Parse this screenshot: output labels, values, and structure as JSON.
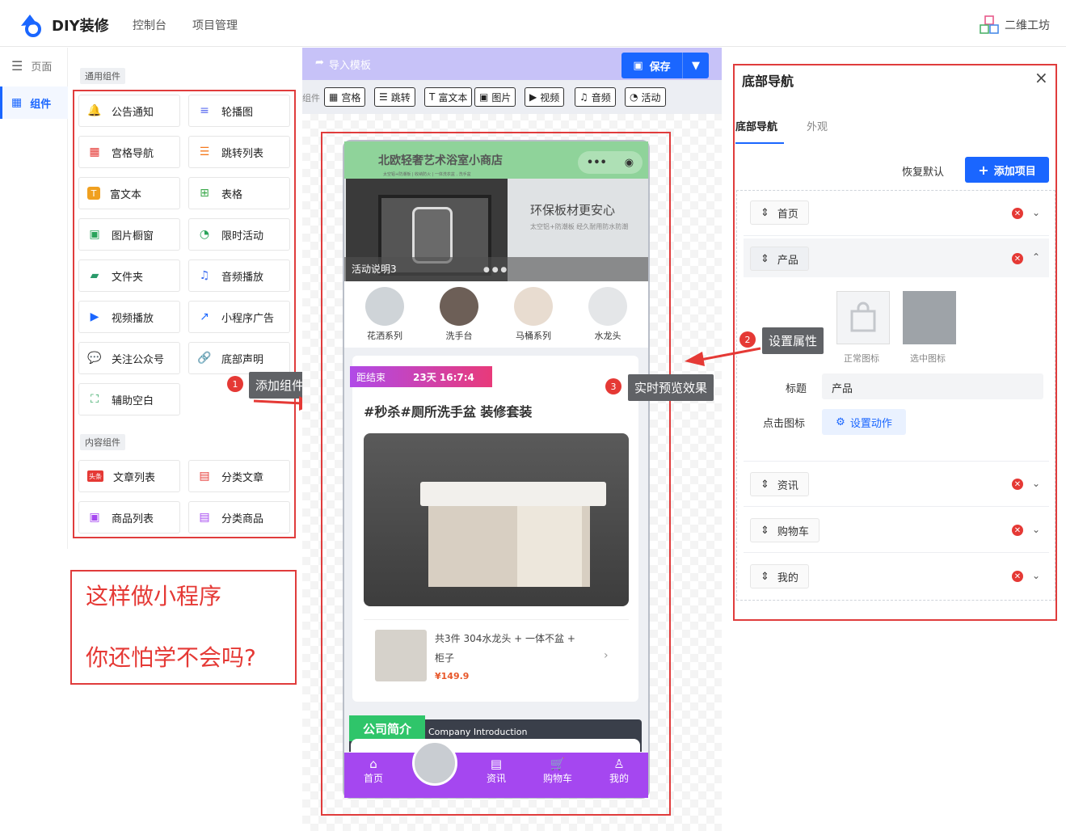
{
  "header": {
    "brand": "DIY装修",
    "nav": [
      "控制台",
      "项目管理"
    ],
    "user": "二维工坊",
    "brand_color": "#1a66ff"
  },
  "sidebar": {
    "items": [
      {
        "label": "页面",
        "icon": "menu-icon"
      },
      {
        "label": "组件",
        "icon": "grid-icon"
      }
    ]
  },
  "components": {
    "general_tag": "通用组件",
    "general": [
      "公告通知",
      "轮播图",
      "宫格导航",
      "跳转列表",
      "富文本",
      "表格",
      "图片橱窗",
      "限时活动",
      "文件夹",
      "音频播放",
      "视频播放",
      "小程序广告",
      "关注公众号",
      "底部声明",
      "辅助空白"
    ],
    "content_tag": "内容组件",
    "content": [
      "文章列表",
      "分类文章",
      "商品列表",
      "分类商品"
    ]
  },
  "annotations": {
    "add_component": "添加组件",
    "set_props": "设置属性",
    "preview": "实时预览效果",
    "n1": "1",
    "n2": "2",
    "n3": "3",
    "promo_line1": "这样做小程序",
    "promo_line2": "你还怕学不会吗?"
  },
  "canvas": {
    "import": "导入模板",
    "save": "保存",
    "tool_cut": "组件",
    "tools": [
      "宫格",
      "跳转",
      "富文本",
      "图片",
      "视频",
      "音频",
      "活动"
    ]
  },
  "phone": {
    "shop_title": "北欧轻奢艺术浴室小商店",
    "banner_caption": "环保板材更安心",
    "banner_sub": "太空铝+防潮板 经久耐用防水防潮",
    "banner_small": "太空铝+防潮板  |  收纳防火  |  一体洗衣盆 , 洗手盆",
    "activity_text": "活动说明3",
    "categories": [
      "花洒系列",
      "洗手台",
      "马桶系列",
      "水龙头"
    ],
    "countdown_label": "距结束",
    "countdown": "23天 16:7:4",
    "product_title": "#秒杀#厕所洗手盆 装修套装",
    "item_desc1": "共3件 304水龙头 + 一体不盆 +",
    "item_desc2": "柜子",
    "price": "¥149.9",
    "intro_title": "公司简介",
    "intro_en": "Company Introduction",
    "bottom_nav": [
      "首页",
      "资讯",
      "购物车",
      "我的"
    ]
  },
  "right": {
    "title": "底部导航",
    "tabs": [
      "底部导航",
      "外观"
    ],
    "reset": "恢复默认",
    "add": "添加项目",
    "items": [
      "首页",
      "产品",
      "资讯",
      "购物车",
      "我的"
    ],
    "icon_normal": "正常图标",
    "icon_selected": "选中图标",
    "field_title_label": "标题",
    "field_title_value": "产品",
    "field_click_label": "点击图标",
    "action_btn": "设置动作"
  }
}
